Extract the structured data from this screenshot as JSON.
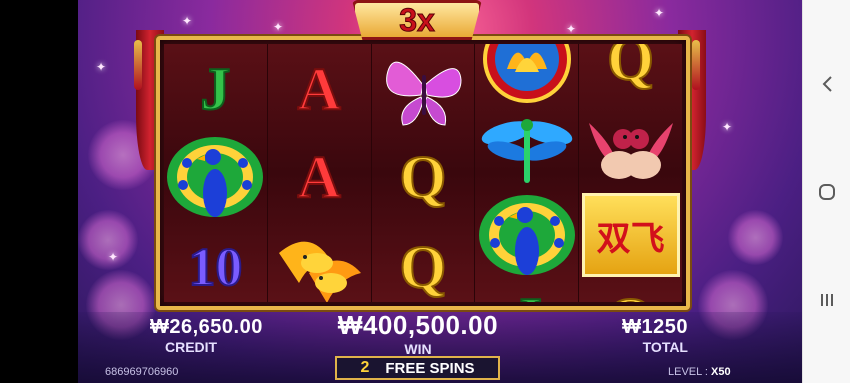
{
  "multiplier": "3x",
  "reels": [
    [
      "J",
      "peacock",
      "10"
    ],
    [
      "A",
      "A",
      "golden-birds"
    ],
    [
      "butterfly",
      "Q",
      "Q"
    ],
    [
      "lotus",
      "dragonfly",
      "peacock",
      "J"
    ],
    [
      "Q",
      "mandarin-ducks",
      "double-fly-wild",
      "Q"
    ]
  ],
  "wild_text": "双飞",
  "credit": {
    "value": "₩26,650.00",
    "label": "CREDIT"
  },
  "win": {
    "value": "₩400,500.00",
    "label": "WIN"
  },
  "total": {
    "value": "₩1250",
    "label": "TOTAL"
  },
  "free_spins": {
    "count": "2",
    "label": "FREE SPINS"
  },
  "session_id": "686969706960",
  "level": {
    "label": "LEVEL :",
    "value": "X50"
  },
  "nav": {
    "back_icon": "chevron-left-icon",
    "home_icon": "circle-home-icon",
    "recents_icon": "recents-bars-icon"
  },
  "colors": {
    "frame": "#e8b74a",
    "reel_bg": "#3a070d",
    "win_text": "#ffffff",
    "multiplier_text": "#c8101b"
  }
}
